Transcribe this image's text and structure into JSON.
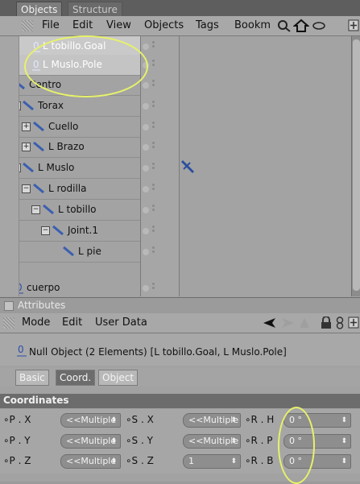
{
  "tabs": {
    "objects": "Objects",
    "structure": "Structure"
  },
  "menubar": {
    "file": "File",
    "edit": "Edit",
    "view": "View",
    "objects": "Objects",
    "tags": "Tags",
    "bookmarks": "Bookm"
  },
  "tree": [
    {
      "name": "L tobillo.Goal",
      "type": "null",
      "selected": true
    },
    {
      "name": "L Muslo.Pole",
      "type": "null",
      "selected": true
    },
    {
      "name": "Centro",
      "type": "bone"
    },
    {
      "name": "Torax",
      "type": "bone"
    },
    {
      "name": "Cuello",
      "type": "bone"
    },
    {
      "name": "L Brazo",
      "type": "bone"
    },
    {
      "name": "L Muslo",
      "type": "bone"
    },
    {
      "name": "L rodilla",
      "type": "bone"
    },
    {
      "name": "L tobillo",
      "type": "bone"
    },
    {
      "name": "Joint.1",
      "type": "bone"
    },
    {
      "name": "L pie",
      "type": "bone"
    },
    {
      "name": "cuerpo",
      "type": "null"
    }
  ],
  "attributes": {
    "title": "Attributes",
    "menu": {
      "mode": "Mode",
      "edit": "Edit",
      "userdata": "User Data"
    },
    "info": "Null Object (2 Elements) [L tobillo.Goal, L Muslo.Pole]",
    "subtabs": {
      "basic": "Basic",
      "coord": "Coord.",
      "object": "Object"
    },
    "section": "Coordinates",
    "fields": {
      "px": {
        "label": "P . X",
        "value": "<<Multiple"
      },
      "py": {
        "label": "P . Y",
        "value": "<<Multiple"
      },
      "pz": {
        "label": "P . Z",
        "value": "<<Multiple"
      },
      "sx": {
        "label": "S . X",
        "value": "<<Multiple"
      },
      "sy": {
        "label": "S . Y",
        "value": "<<Multiple"
      },
      "sz": {
        "label": "S . Z",
        "value": "1"
      },
      "rh": {
        "label": "R . H",
        "value": "0 °"
      },
      "rp": {
        "label": "R . P",
        "value": "0 °"
      },
      "rb": {
        "label": "R . B",
        "value": "0 °"
      }
    }
  },
  "colors": {
    "highlight": "#e7f26a",
    "panel": "#a8a8a8",
    "header": "#6c6c6c"
  }
}
